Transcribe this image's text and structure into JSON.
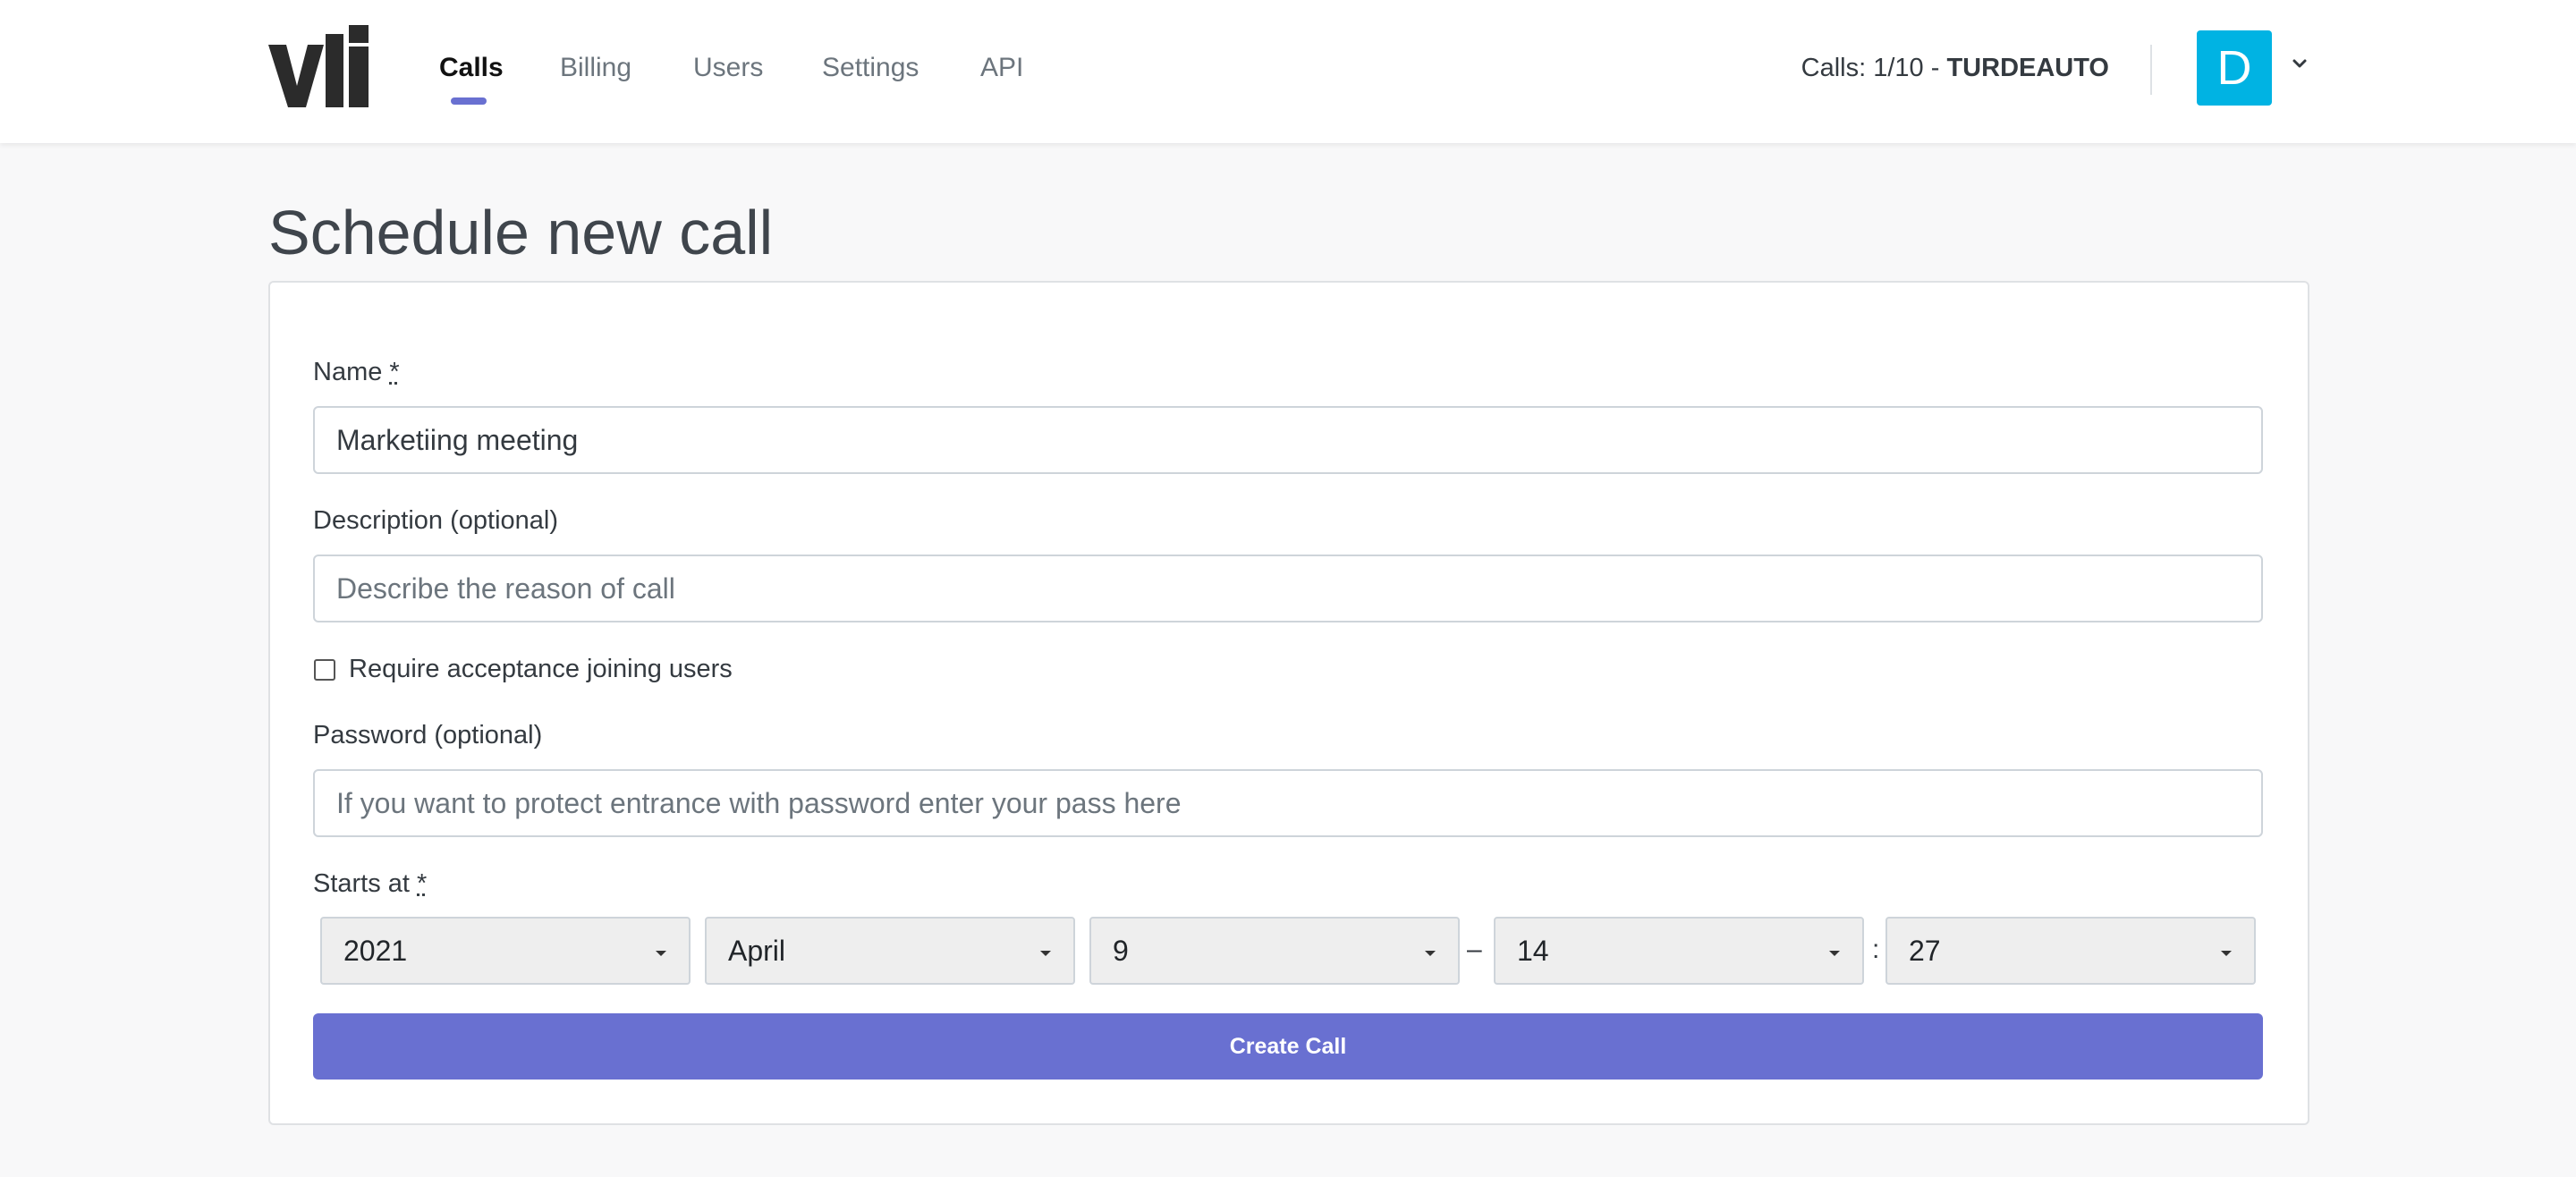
{
  "header": {
    "logo_text": "vli",
    "nav": [
      {
        "label": "Calls",
        "active": true
      },
      {
        "label": "Billing",
        "active": false
      },
      {
        "label": "Users",
        "active": false
      },
      {
        "label": "Settings",
        "active": false
      },
      {
        "label": "API",
        "active": false
      }
    ],
    "calls_count_prefix": "Calls: 1/10 - ",
    "account_name": "TURDEAUTO",
    "avatar_letter": "D",
    "accent_color": "#6970d1",
    "avatar_color": "#00b3e3",
    "dropdown_icon": "chevron-down-icon"
  },
  "main": {
    "title": "Schedule new call",
    "form": {
      "name_label": "Name ",
      "required_mark": "*",
      "name_value": "Marketiing meeting",
      "description_label": "Description (optional)",
      "description_placeholder": "Describe the reason of call",
      "require_acceptance_label": "Require acceptance joining users",
      "require_acceptance_checked": false,
      "password_label": "Password (optional)",
      "password_placeholder": "If you want to protect entrance with password enter your pass here",
      "starts_at_label": "Starts at ",
      "year": "2021",
      "month": "April",
      "day": "9",
      "date_time_separator": "–",
      "hour": "14",
      "time_separator": ":",
      "minute": "27",
      "submit_label": "Create Call"
    }
  }
}
